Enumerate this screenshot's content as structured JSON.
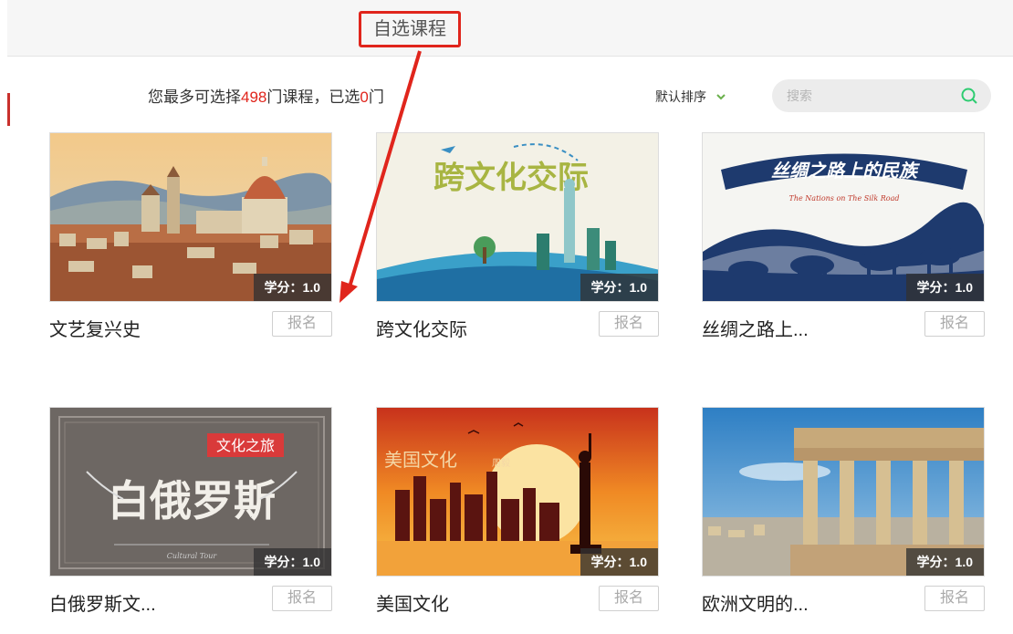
{
  "tabs": {
    "active_label": "自选课程"
  },
  "info": {
    "prefix": "您最多可选择",
    "max_count": "498",
    "middle": "门课程，已选",
    "selected_count": "0",
    "suffix": "门"
  },
  "toolbar": {
    "sort_label": "默认排序",
    "search_placeholder": "搜索"
  },
  "courses": [
    {
      "title": "文艺复兴史",
      "credit": "学分：1.0",
      "enroll_label": "报名",
      "image": "florence-cathedral"
    },
    {
      "title": "跨文化交际",
      "credit": "学分：1.0",
      "enroll_label": "报名",
      "image": "statue-of-liberty-cartoon",
      "art_text": "跨文化交际"
    },
    {
      "title": "丝绸之路上...",
      "credit": "学分：1.0",
      "enroll_label": "报名",
      "image": "camel-caravan",
      "art_text": "丝绸之路上的民族",
      "art_subtext": "The Nations on The Silk Road"
    },
    {
      "title": "白俄罗斯文...",
      "credit": "学分：1.0",
      "enroll_label": "报名",
      "image": "belarus-chalkboard",
      "art_text": "白俄罗斯",
      "art_tag": "文化之旅",
      "art_footer": "Cultural Tour"
    },
    {
      "title": "美国文化",
      "credit": "学分：1.0",
      "enroll_label": "报名",
      "image": "nyc-sunset",
      "art_text": "美国文化",
      "art_tag": "周毅"
    },
    {
      "title": "欧洲文明的...",
      "credit": "学分：1.0",
      "enroll_label": "报名",
      "image": "greek-temple"
    }
  ],
  "colors": {
    "accent": "#e0251c",
    "sort_chevron": "#6ab04c",
    "search_icon": "#2ecc71"
  }
}
